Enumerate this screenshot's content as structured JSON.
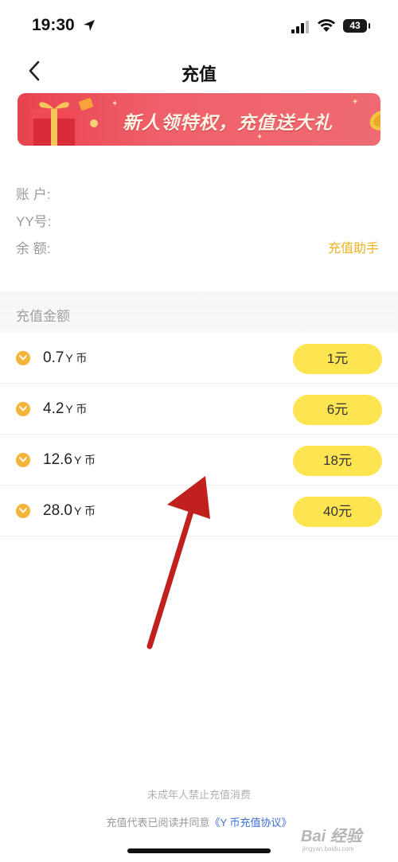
{
  "status_bar": {
    "time": "19:30",
    "battery": "43"
  },
  "nav": {
    "title": "充值"
  },
  "banner": {
    "text": "新人领特权，充值送大礼"
  },
  "account": {
    "account_label": "账 户:",
    "yy_label": "YY号:",
    "balance_label": "余 额:",
    "helper_link": "充值助手"
  },
  "section": {
    "label": "充值金额"
  },
  "options": [
    {
      "amount": "0.7",
      "unit": "Y 币",
      "price": "1元"
    },
    {
      "amount": "4.2",
      "unit": "Y 币",
      "price": "6元"
    },
    {
      "amount": "12.6",
      "unit": "Y 币",
      "price": "18元"
    },
    {
      "amount": "28.0",
      "unit": "Y 币",
      "price": "40元"
    }
  ],
  "footer": {
    "note": "未成年人禁止充值消费",
    "agree_prefix": "充值代表已阅读并同意",
    "agree_link": "《Y 币充值协议》"
  },
  "watermark": {
    "text": "Bai 经验",
    "sub": "jingyan.baidu.com"
  },
  "colors": {
    "accent_yellow": "#fde552",
    "helper_gold": "#f0b320",
    "banner_red": "#ef5a64",
    "arrow_red": "#c0201e",
    "link_blue": "#3b6fd8"
  },
  "icons": [
    "location-arrow-icon",
    "signal-icon",
    "wifi-icon",
    "battery-icon",
    "back-chevron-icon",
    "gift-box-icon",
    "gold-coin-icon",
    "y-coin-icon"
  ]
}
